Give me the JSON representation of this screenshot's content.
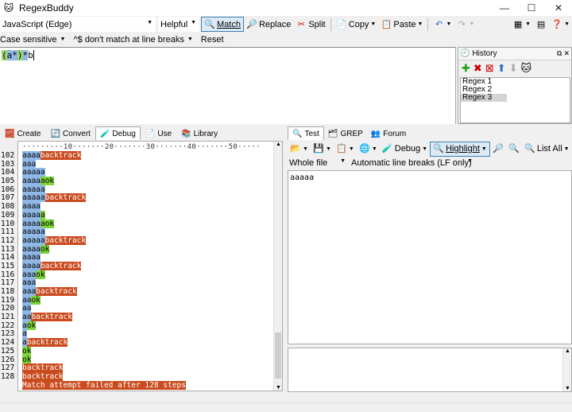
{
  "app": {
    "title": "RegexBuddy"
  },
  "window_controls": {
    "minimize": "—",
    "maximize": "☐",
    "close": "✕"
  },
  "toolbar": {
    "flavor": "JavaScript (Edge)",
    "helpful": "Helpful",
    "match": "Match",
    "replace": "Replace",
    "split": "Split",
    "copy": "Copy",
    "paste": "Paste"
  },
  "options": {
    "case": "Case sensitive",
    "anchors": "^$ don't match at line breaks",
    "reset": "Reset"
  },
  "regex": {
    "parts": [
      "(",
      "a*",
      ")",
      "*",
      "b"
    ]
  },
  "history": {
    "title": "History",
    "items": [
      "Regex 1",
      "Regex 2",
      "Regex 3"
    ],
    "selected_index": 2
  },
  "left_tabs": [
    "Create",
    "Convert",
    "Debug",
    "Use",
    "Library"
  ],
  "left_active_tab": "Debug",
  "ruler": "·········10·······20·······30·······40·······50·····",
  "debug_lines": [
    {
      "n": "102",
      "segs": [
        [
          "aaaa",
          "blue"
        ],
        [
          "backtrack",
          "orange"
        ]
      ]
    },
    {
      "n": "103",
      "segs": [
        [
          "aaa",
          "blue"
        ]
      ]
    },
    {
      "n": "104",
      "segs": [
        [
          "aaaaa",
          "blue"
        ]
      ]
    },
    {
      "n": "105",
      "segs": [
        [
          "aaaa",
          "blue"
        ],
        [
          "a",
          "green"
        ],
        [
          "ok",
          "green"
        ]
      ]
    },
    {
      "n": "106",
      "segs": [
        [
          "aaaaa",
          "blue"
        ]
      ]
    },
    {
      "n": "107",
      "segs": [
        [
          "aaaaa",
          "blue"
        ],
        [
          "backtrack",
          "orange"
        ]
      ]
    },
    {
      "n": "108",
      "segs": [
        [
          "aaaa",
          "blue"
        ]
      ]
    },
    {
      "n": "109",
      "segs": [
        [
          "aaaa",
          "blue"
        ],
        [
          "a",
          "green"
        ]
      ]
    },
    {
      "n": "110",
      "segs": [
        [
          "aaaa",
          "blue"
        ],
        [
          "a",
          "green"
        ],
        [
          "ok",
          "green"
        ]
      ]
    },
    {
      "n": "111",
      "segs": [
        [
          "aaaaa",
          "blue"
        ]
      ]
    },
    {
      "n": "112",
      "segs": [
        [
          "aaaaa",
          "blue"
        ],
        [
          "backtrack",
          "orange"
        ]
      ]
    },
    {
      "n": "113",
      "segs": [
        [
          "aaaa",
          "blue"
        ],
        [
          "ok",
          "green"
        ]
      ]
    },
    {
      "n": "114",
      "segs": [
        [
          "aaaa",
          "blue"
        ]
      ]
    },
    {
      "n": "115",
      "segs": [
        [
          "aaaa",
          "blue"
        ],
        [
          "backtrack",
          "orange"
        ]
      ]
    },
    {
      "n": "116",
      "segs": [
        [
          "aaa",
          "blue"
        ],
        [
          "ok",
          "green"
        ]
      ]
    },
    {
      "n": "117",
      "segs": [
        [
          "aaa",
          "blue"
        ]
      ]
    },
    {
      "n": "118",
      "segs": [
        [
          "aaa",
          "blue"
        ],
        [
          "backtrack",
          "orange"
        ]
      ]
    },
    {
      "n": "119",
      "segs": [
        [
          "aa",
          "blue"
        ],
        [
          "ok",
          "green"
        ]
      ]
    },
    {
      "n": "120",
      "segs": [
        [
          "aa",
          "blue"
        ]
      ]
    },
    {
      "n": "121",
      "segs": [
        [
          "aa",
          "blue"
        ],
        [
          "backtrack",
          "orange"
        ]
      ]
    },
    {
      "n": "122",
      "segs": [
        [
          "a",
          "blue"
        ],
        [
          "ok",
          "green"
        ]
      ]
    },
    {
      "n": "123",
      "segs": [
        [
          "a",
          "blue"
        ]
      ]
    },
    {
      "n": "124",
      "segs": [
        [
          "a",
          "blue"
        ],
        [
          "backtrack",
          "orange"
        ]
      ]
    },
    {
      "n": "125",
      "segs": [
        [
          "ok",
          "green"
        ]
      ]
    },
    {
      "n": "126",
      "segs": [
        [
          "ok",
          "green"
        ]
      ]
    },
    {
      "n": "127",
      "segs": [
        [
          "backtrack",
          "orange"
        ]
      ]
    },
    {
      "n": "128",
      "segs": [
        [
          "backtrack",
          "orange"
        ]
      ]
    },
    {
      "n": "",
      "segs": [
        [
          "Match attempt failed after 128 steps",
          "orange"
        ]
      ]
    }
  ],
  "right_tabs": [
    "Test",
    "GREP",
    "Forum"
  ],
  "right_active_tab": "Test",
  "test_toolbar": {
    "debug": "Debug",
    "highlight": "Highlight",
    "list_all": "List All"
  },
  "test_options": {
    "scope": "Whole file",
    "line_breaks": "Automatic line breaks (LF only)"
  },
  "test_text": "aaaaa",
  "colors": {
    "blue": "#8fb8e8",
    "green": "#7ed43b",
    "orange": "#c94b1e"
  }
}
